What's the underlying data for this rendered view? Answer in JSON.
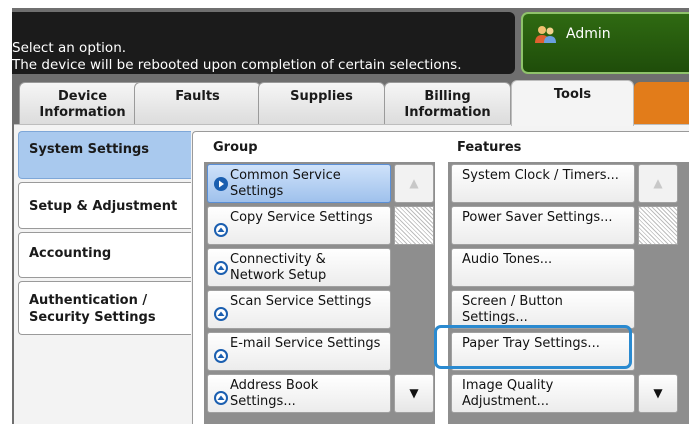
{
  "header": {
    "message_line1": "Select an option.",
    "message_line2": "The device will be rebooted upon completion of certain selections.",
    "user_label": "Admin"
  },
  "tabs": [
    {
      "label_line1": "Device",
      "label_line2": "Information"
    },
    {
      "label_line1": "Faults",
      "label_line2": ""
    },
    {
      "label_line1": "Supplies",
      "label_line2": ""
    },
    {
      "label_line1": "Billing",
      "label_line2": "Information"
    },
    {
      "label_line1": "Tools",
      "label_line2": ""
    }
  ],
  "sidebar": {
    "items": [
      {
        "label": "System Settings",
        "selected": true
      },
      {
        "label": "Setup & Adjustment"
      },
      {
        "label": "Accounting"
      },
      {
        "label_line1": "Authentication /",
        "label_line2": "Security Settings"
      }
    ]
  },
  "group": {
    "header": "Group",
    "items": [
      {
        "line1": "Common Service",
        "line2": "Settings",
        "selected": true
      },
      {
        "line1": "Copy Service Settings",
        "line2": ""
      },
      {
        "line1": "Connectivity &",
        "line2": "Network Setup"
      },
      {
        "line1": "Scan Service Settings",
        "line2": ""
      },
      {
        "line1": "E-mail Service Settings",
        "line2": ""
      },
      {
        "line1": "Address Book Settings...",
        "line2": ""
      }
    ]
  },
  "features": {
    "header": "Features",
    "items": [
      {
        "line1": "System Clock / Timers...",
        "line2": ""
      },
      {
        "line1": "Power Saver Settings...",
        "line2": ""
      },
      {
        "line1": "Audio Tones...",
        "line2": ""
      },
      {
        "line1": "Screen / Button",
        "line2": "Settings..."
      },
      {
        "line1": "Paper Tray Settings...",
        "line2": "",
        "highlighted": true
      },
      {
        "line1": "Image Quality",
        "line2": "Adjustment..."
      }
    ]
  },
  "scroll": {
    "up_glyph": "▲",
    "down_glyph": "▼"
  },
  "colors": {
    "accent_blue": "#2a8ad0",
    "admin_green": "#2f6a12",
    "tab_orange": "#e27c1a",
    "selected_blue": "#a9c9ee"
  }
}
